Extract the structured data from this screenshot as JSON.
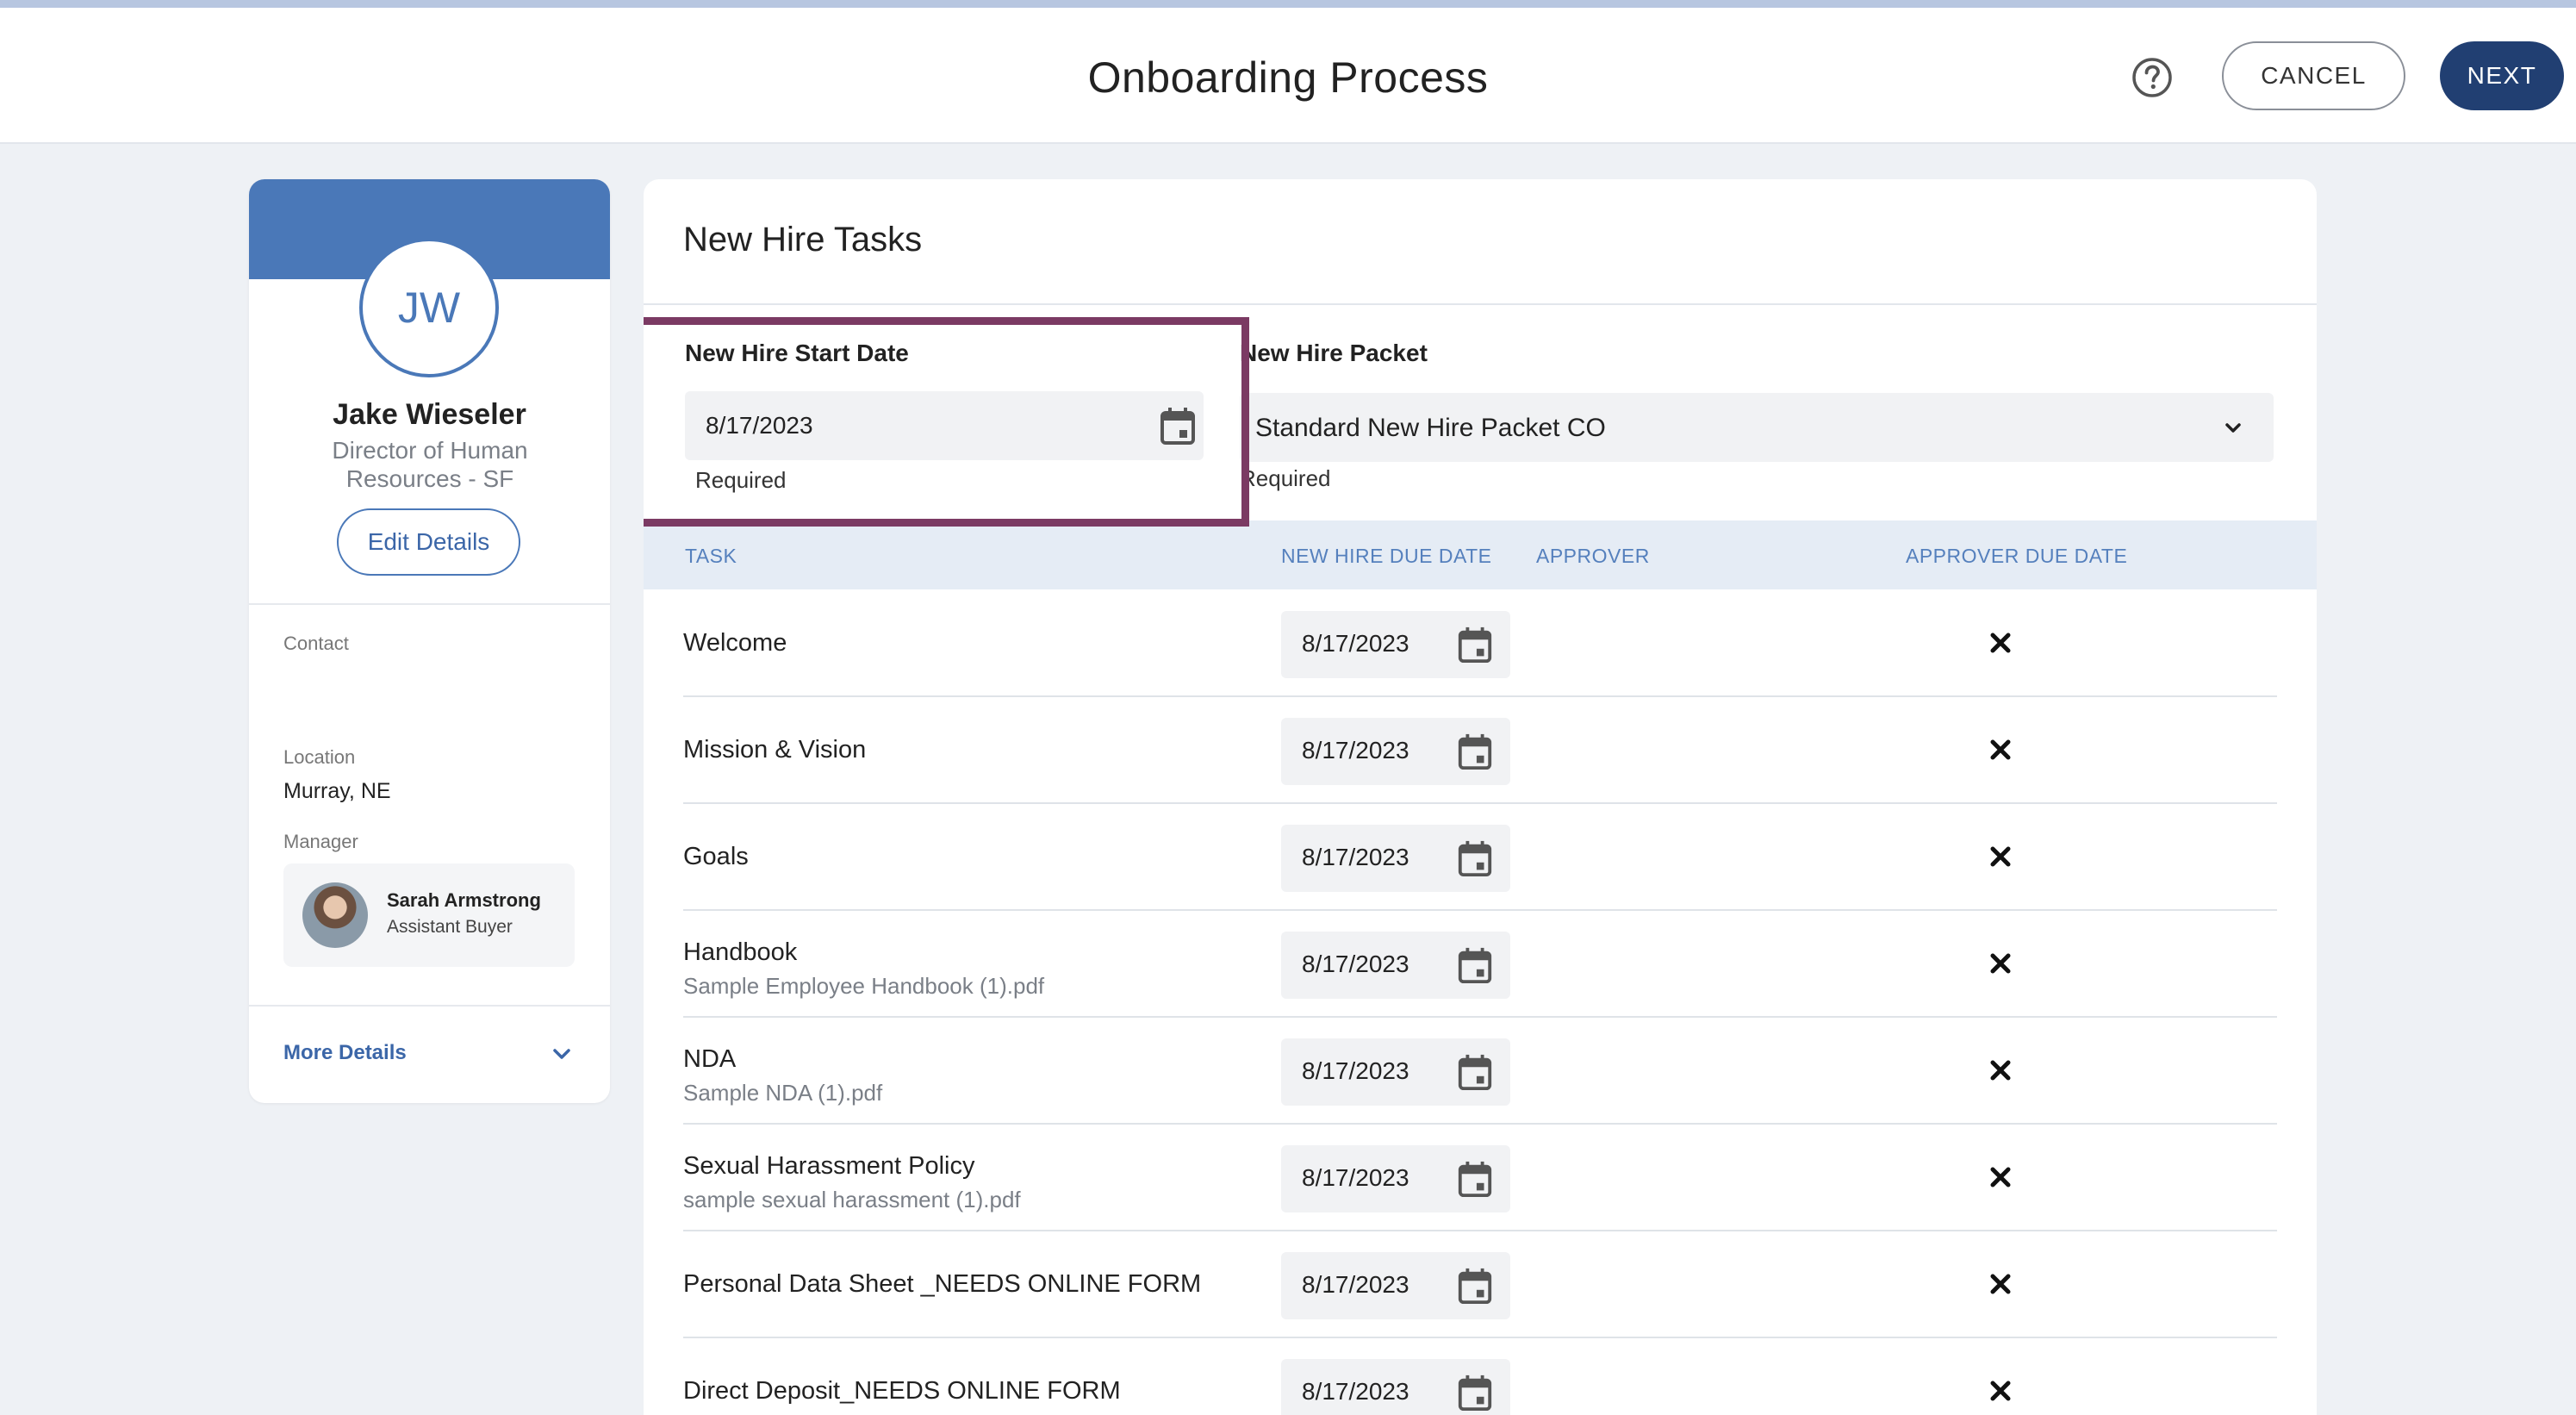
{
  "header": {
    "title": "Onboarding Process",
    "cancel_label": "CANCEL",
    "next_label": "NEXT"
  },
  "profile": {
    "initials": "JW",
    "name": "Jake Wieseler",
    "title": "Director of Human Resources - SF",
    "edit_label": "Edit Details",
    "contact_label": "Contact",
    "location_label": "Location",
    "location_value": "Murray, NE",
    "manager_label": "Manager",
    "manager_name": "Sarah Armstrong",
    "manager_role": "Assistant Buyer",
    "more_details_label": "More Details"
  },
  "panel": {
    "title": "New Hire Tasks",
    "start_date_label": "New Hire Start Date",
    "start_date_value": "8/17/2023",
    "start_date_help": "Required",
    "packet_label": "New Hire Packet",
    "packet_value": "Standard New Hire Packet CO",
    "packet_help": "Required"
  },
  "table": {
    "columns": [
      "TASK",
      "NEW HIRE DUE DATE",
      "APPROVER",
      "APPROVER DUE DATE"
    ],
    "rows": [
      {
        "task": "Welcome",
        "file": "",
        "due": "8/17/2023"
      },
      {
        "task": "Mission & Vision",
        "file": "",
        "due": "8/17/2023"
      },
      {
        "task": "Goals",
        "file": "",
        "due": "8/17/2023"
      },
      {
        "task": "Handbook",
        "file": "Sample Employee Handbook (1).pdf",
        "due": "8/17/2023"
      },
      {
        "task": "NDA",
        "file": "Sample NDA (1).pdf",
        "due": "8/17/2023"
      },
      {
        "task": "Sexual Harassment Policy",
        "file": "sample sexual harassment (1).pdf",
        "due": "8/17/2023"
      },
      {
        "task": "Personal Data Sheet _NEEDS ONLINE FORM",
        "file": "",
        "due": "8/17/2023"
      },
      {
        "task": "Direct Deposit_NEEDS ONLINE FORM",
        "file": "",
        "due": "8/17/2023"
      }
    ]
  },
  "icons": {
    "help": "help-circle-icon",
    "calendar": "calendar-icon",
    "chevron": "chevron-down-icon",
    "remove": "close-icon"
  },
  "colors": {
    "primary": "#213f72",
    "accent": "#4a78b8",
    "highlight": "#7b3a63",
    "table_header_bg": "#e5ecf5"
  }
}
